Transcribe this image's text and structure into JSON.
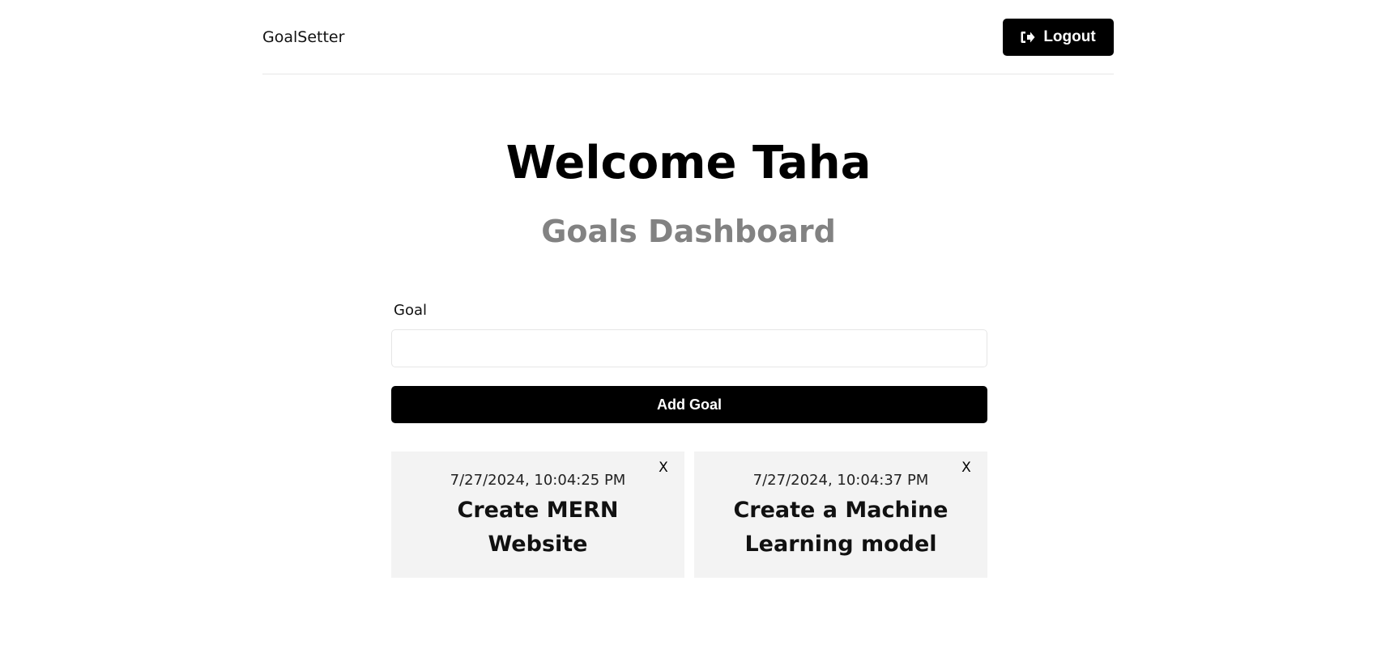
{
  "header": {
    "brand": "GoalSetter",
    "logout_label": "Logout",
    "logout_icon": "sign-out-icon"
  },
  "main": {
    "heading": "Welcome Taha",
    "subheading": "Goals Dashboard"
  },
  "form": {
    "goal_label": "Goal",
    "goal_value": "",
    "add_button_label": "Add Goal"
  },
  "goals": [
    {
      "date": "7/27/2024, 10:04:25 PM",
      "text": "Create MERN Website",
      "close_label": "X"
    },
    {
      "date": "7/27/2024, 10:04:37 PM",
      "text": "Create a Machine Learning model",
      "close_label": "X"
    }
  ],
  "colors": {
    "primary": "#000000",
    "subheading": "#828282",
    "card_background": "#f3f3f3"
  }
}
